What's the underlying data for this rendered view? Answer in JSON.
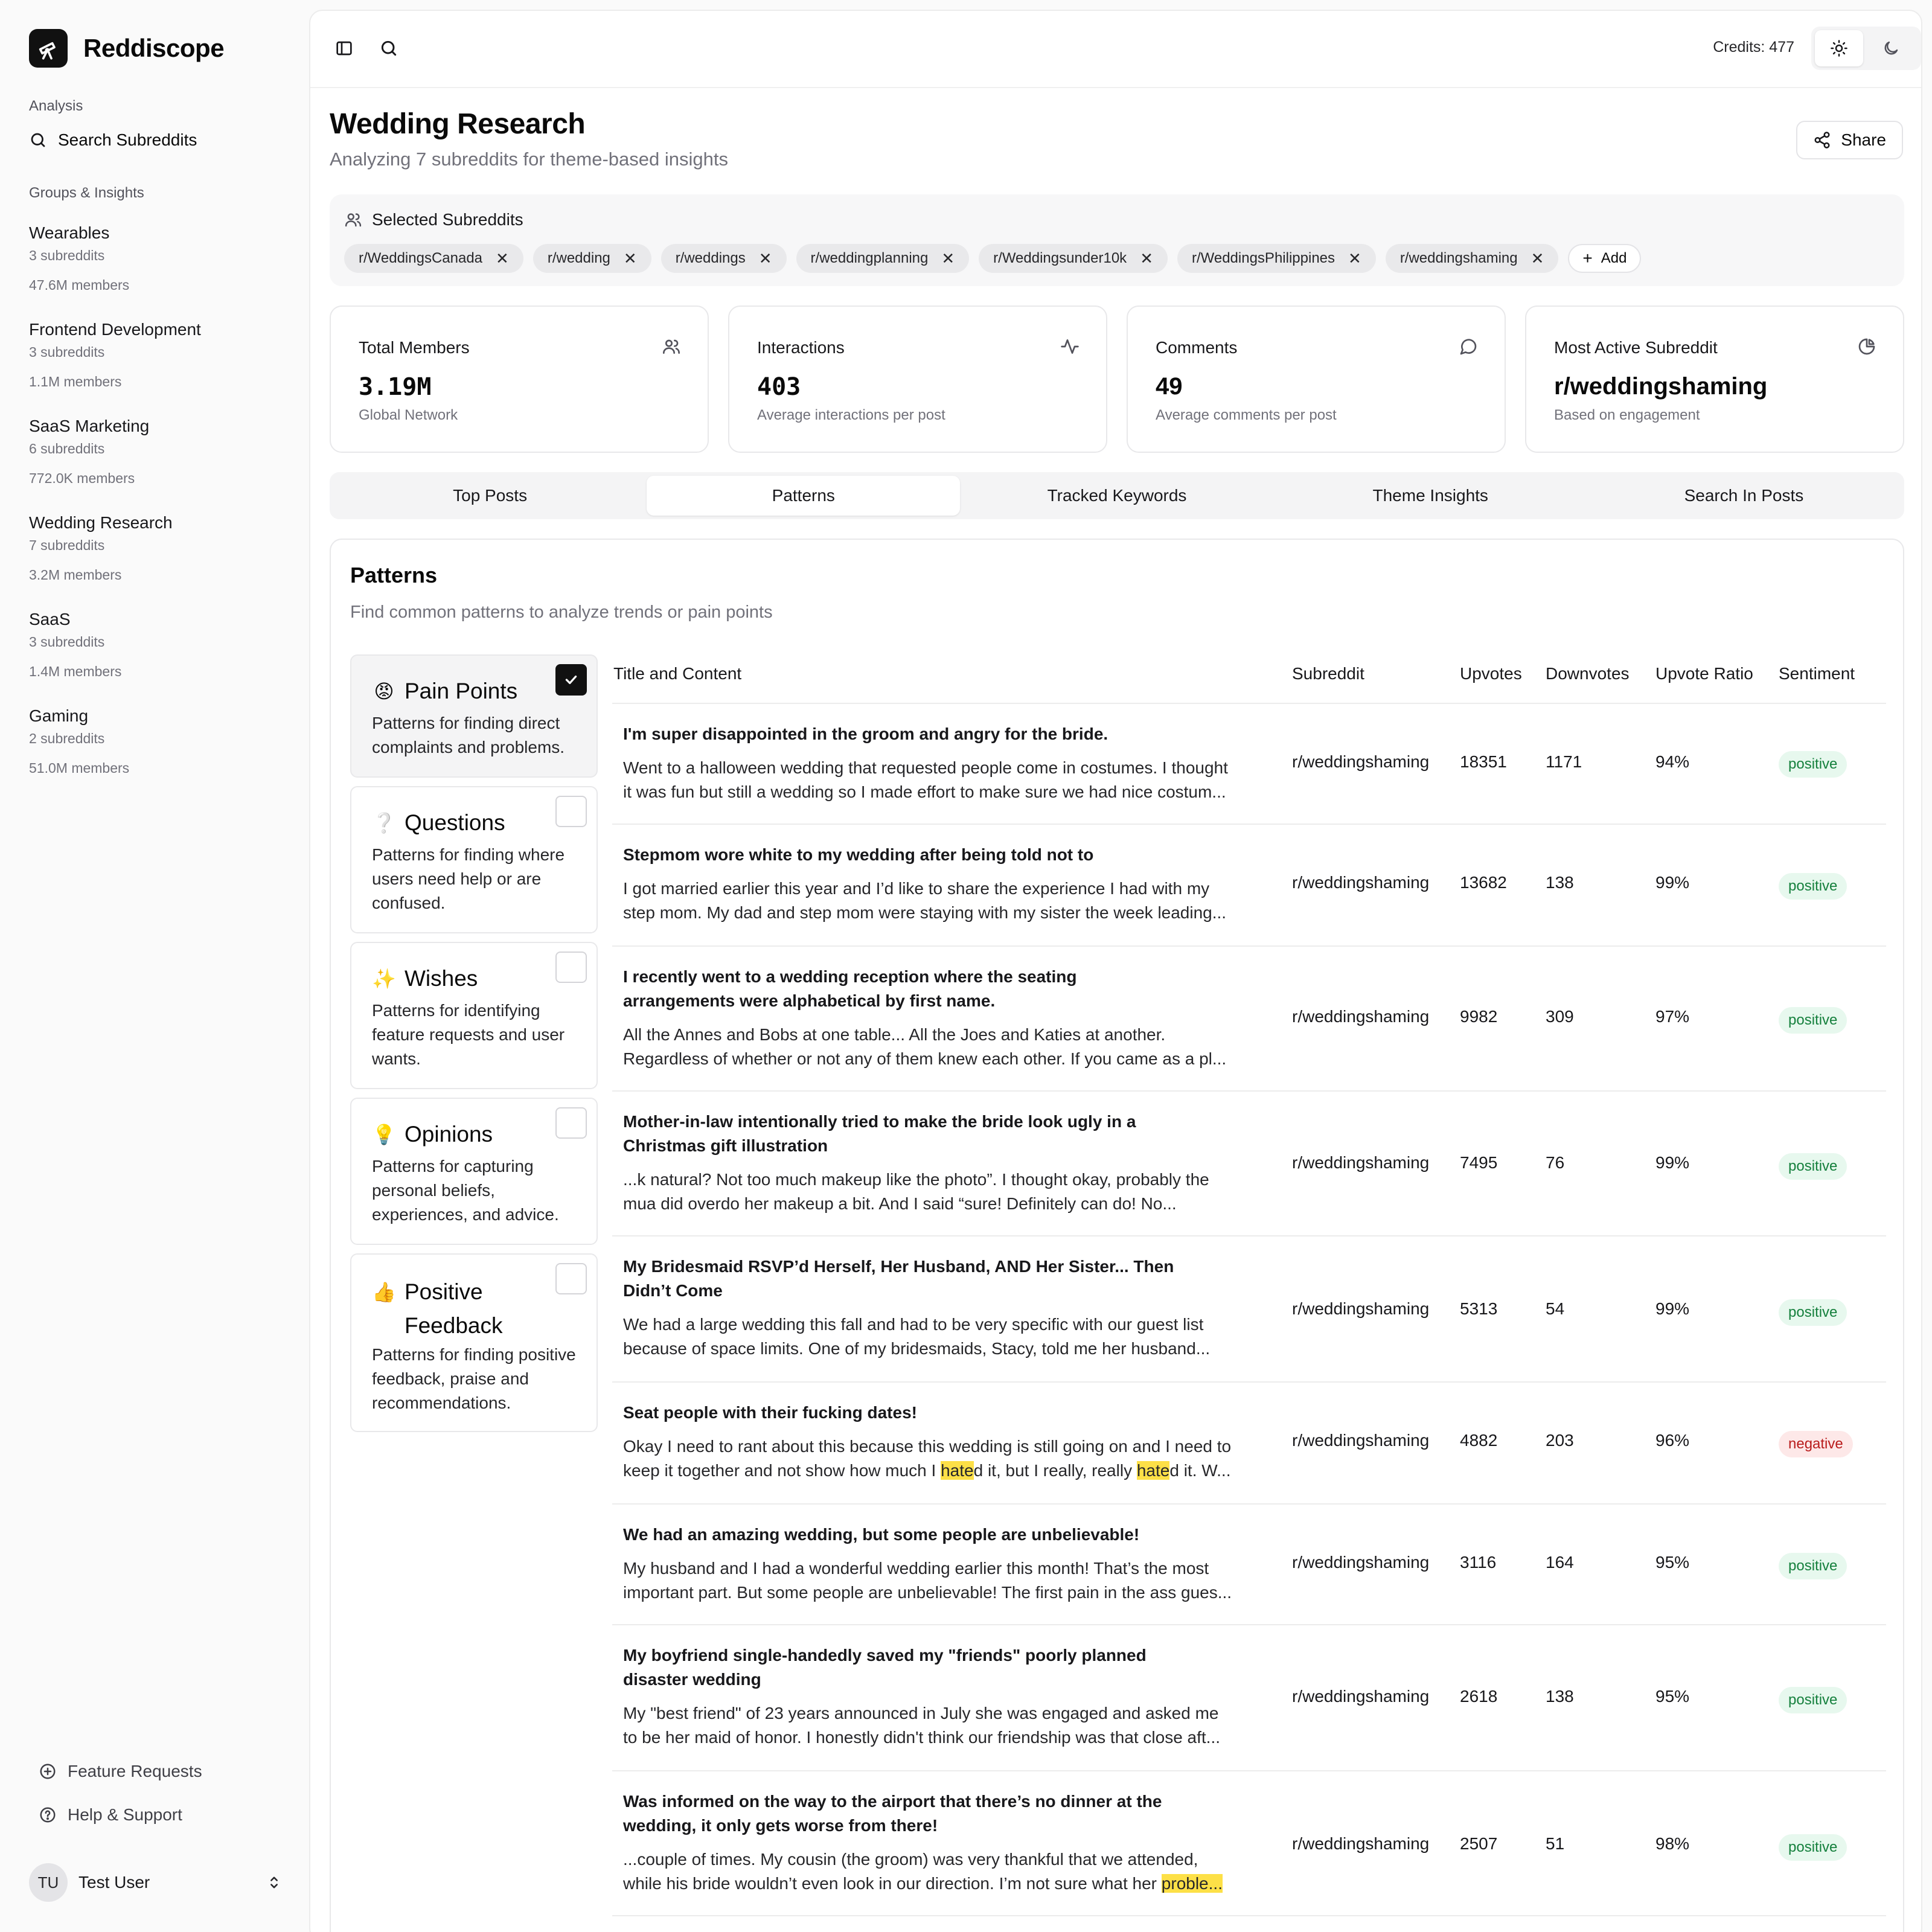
{
  "app": {
    "name": "Reddiscope"
  },
  "sidebar": {
    "analysis_label": "Analysis",
    "search_label": "Search Subreddits",
    "groups_label": "Groups & Insights",
    "groups": [
      {
        "name": "Wearables",
        "subreddits": "3 subreddits",
        "members": "47.6M members"
      },
      {
        "name": "Frontend Development",
        "subreddits": "3 subreddits",
        "members": "1.1M members"
      },
      {
        "name": "SaaS Marketing",
        "subreddits": "6 subreddits",
        "members": "772.0K members"
      },
      {
        "name": "Wedding Research",
        "subreddits": "7 subreddits",
        "members": "3.2M members"
      },
      {
        "name": "SaaS",
        "subreddits": "3 subreddits",
        "members": "1.4M members"
      },
      {
        "name": "Gaming",
        "subreddits": "2 subreddits",
        "members": "51.0M members"
      }
    ],
    "feature_requests": "Feature Requests",
    "help_support": "Help & Support",
    "user": {
      "initials": "TU",
      "name": "Test User"
    }
  },
  "topbar": {
    "credits": "Credits: 477"
  },
  "page": {
    "title": "Wedding Research",
    "subtitle": "Analyzing 7 subreddits for theme-based insights",
    "share_label": "Share"
  },
  "selected": {
    "label": "Selected Subreddits",
    "chips": [
      "r/WeddingsCanada",
      "r/wedding",
      "r/weddings",
      "r/weddingplanning",
      "r/Weddingsunder10k",
      "r/WeddingsPhilippines",
      "r/weddingshaming"
    ],
    "add_label": "Add"
  },
  "stats": [
    {
      "label": "Total Members",
      "value": "3.19M",
      "desc": "Global Network",
      "icon": "users-icon"
    },
    {
      "label": "Interactions",
      "value": "403",
      "desc": "Average interactions per post",
      "icon": "activity-icon"
    },
    {
      "label": "Comments",
      "value": "49",
      "desc": "Average comments per post",
      "icon": "message-circle-icon"
    },
    {
      "label": "Most Active Subreddit",
      "value": "r/weddingshaming",
      "desc": "Based on engagement",
      "icon": "pie-chart-icon"
    }
  ],
  "tabs": [
    "Top Posts",
    "Patterns",
    "Tracked Keywords",
    "Theme Insights",
    "Search In Posts"
  ],
  "patterns": {
    "title": "Patterns",
    "subtitle": "Find common patterns to analyze trends or pain points",
    "cards": [
      {
        "emoji": "😡",
        "title": "Pain Points",
        "desc": "Patterns for finding direct complaints and problems.",
        "checked": true
      },
      {
        "emoji": "❔",
        "title": "Questions",
        "desc": "Patterns for finding where users need help or are confused.",
        "checked": false
      },
      {
        "emoji": "✨",
        "title": "Wishes",
        "desc": "Patterns for identifying feature requests and user wants.",
        "checked": false
      },
      {
        "emoji": "💡",
        "title": "Opinions",
        "desc": "Patterns for capturing personal beliefs, experiences, and advice.",
        "checked": false
      },
      {
        "emoji": "👍",
        "title": "Positive Feedback",
        "desc": "Patterns for finding positive feedback, praise and recommendations.",
        "checked": false
      }
    ]
  },
  "table": {
    "headers": [
      "Title and Content",
      "Subreddit",
      "Upvotes",
      "Downvotes",
      "Upvote Ratio",
      "Sentiment"
    ],
    "rows": [
      {
        "title": "I'm super disappointed in the groom and angry for the bride.",
        "body1": "Went to a halloween wedding that requested people come in costumes. I thought",
        "body2": "it was fun but still a wedding so I made effort to make sure we had nice costum...",
        "subreddit": "r/weddingshaming",
        "upvotes": "18351",
        "downvotes": "1171",
        "ratio": "94%",
        "sentiment": "positive"
      },
      {
        "title": "Stepmom wore white to my wedding after being told not to",
        "body1": "I got married earlier this year and I’d like to share the experience I had with my",
        "body2": "step mom. My dad and step mom were staying with my sister the week leading...",
        "subreddit": "r/weddingshaming",
        "upvotes": "13682",
        "downvotes": "138",
        "ratio": "99%",
        "sentiment": "positive"
      },
      {
        "title1": "I recently went to a wedding reception where the seating",
        "title2": "arrangements were alphabetical by first name.",
        "body1": "All the Annes and Bobs at one table... All the Joes and Katies at another.",
        "body2": "Regardless of whether or not any of them knew each other. If you came as a pl...",
        "subreddit": "r/weddingshaming",
        "upvotes": "9982",
        "downvotes": "309",
        "ratio": "97%",
        "sentiment": "positive"
      },
      {
        "title1": "Mother-in-law intentionally tried to make the bride look ugly in a",
        "title2": "Christmas gift illustration",
        "body1": "...k natural? Not too much makeup like the photo”. I thought okay, probably the",
        "body2": "mua did overdo her makeup a bit. And I said “sure! Definitely can do! No...",
        "subreddit": "r/weddingshaming",
        "upvotes": "7495",
        "downvotes": "76",
        "ratio": "99%",
        "sentiment": "positive"
      },
      {
        "title1": "My Bridesmaid RSVP’d Herself, Her Husband, AND Her Sister... Then",
        "title2": "Didn’t Come",
        "body1": "We had a large wedding this fall and had to be very specific with our guest list",
        "body2": "because of space limits. One of my bridesmaids, Stacy, told me her husband...",
        "subreddit": "r/weddingshaming",
        "upvotes": "5313",
        "downvotes": "54",
        "ratio": "99%",
        "sentiment": "positive"
      },
      {
        "title": "Seat people with their fucking dates!",
        "body1": "Okay I need to rant about this because this wedding is still going on and I need to",
        "body2_a": "keep it together and not show how much I ",
        "hl1": "hate",
        "body2_b": "d it, but I really, really ",
        "hl2": "hate",
        "body2_c": "d it. W...",
        "subreddit": "r/weddingshaming",
        "upvotes": "4882",
        "downvotes": "203",
        "ratio": "96%",
        "sentiment": "negative"
      },
      {
        "title": "We had an amazing wedding, but some people are unbelievable!",
        "body1": "My husband and I had a wonderful wedding earlier this month! That’s the most",
        "body2": "important part. But some people are unbelievable! The first pain in the ass gues...",
        "subreddit": "r/weddingshaming",
        "upvotes": "3116",
        "downvotes": "164",
        "ratio": "95%",
        "sentiment": "positive"
      },
      {
        "title1": "My boyfriend single-handedly saved my \"friends\" poorly planned",
        "title2": "disaster wedding",
        "body1": "My \"best friend\" of 23 years announced in July she was engaged and asked me",
        "body2": "to be her maid of honor. I honestly didn't think our friendship was that close aft...",
        "subreddit": "r/weddingshaming",
        "upvotes": "2618",
        "downvotes": "138",
        "ratio": "95%",
        "sentiment": "positive"
      },
      {
        "title1": "Was informed on the way to the airport that there’s no dinner at the",
        "title2": "wedding, it only gets worse from there!",
        "body1": "...couple of times. My cousin (the groom) was very thankful that we attended,",
        "body2_a": "while his bride wouldn’t even look in our direction. I’m not sure what her ",
        "hl1": "proble...",
        "subreddit": "r/weddingshaming",
        "upvotes": "2507",
        "downvotes": "51",
        "ratio": "98%",
        "sentiment": "positive"
      }
    ]
  }
}
